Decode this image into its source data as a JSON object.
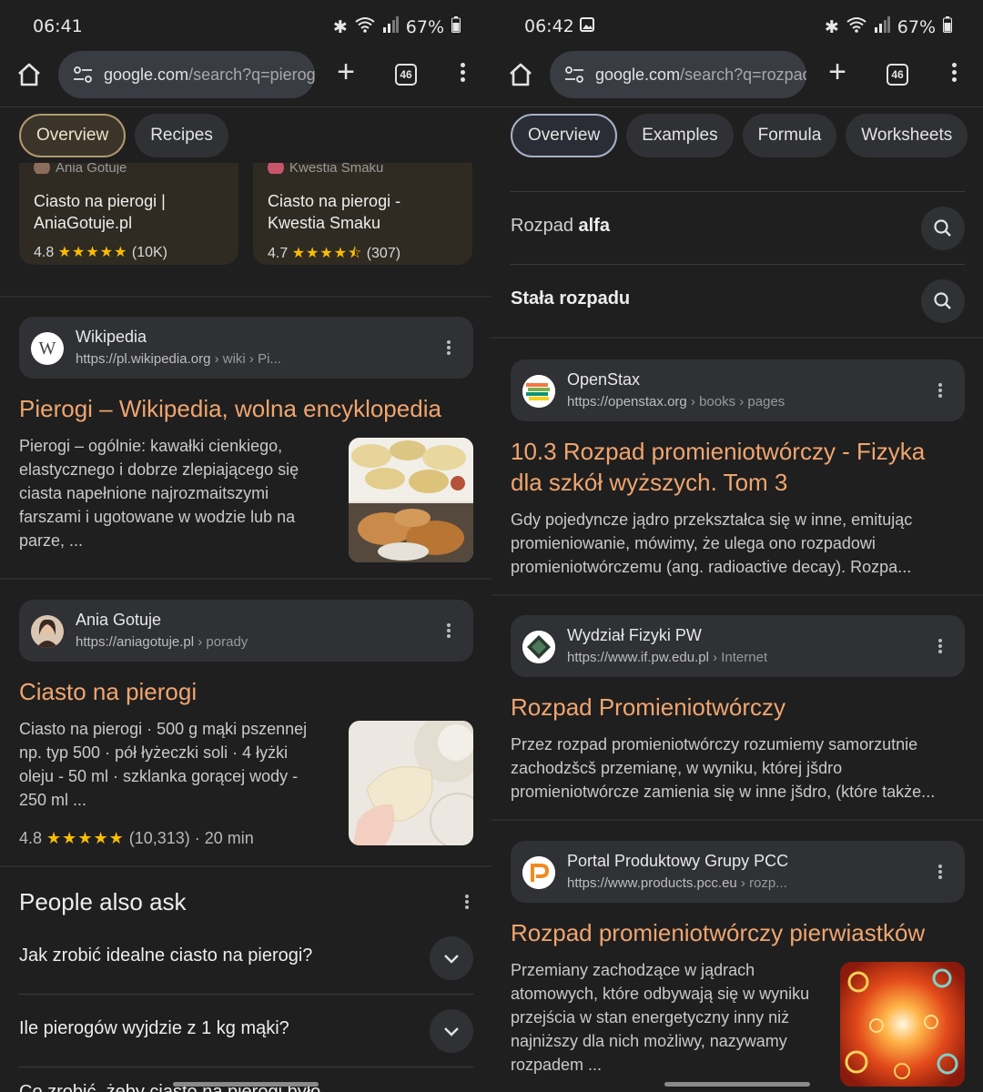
{
  "left": {
    "status": {
      "time": "06:41",
      "battery": "67%"
    },
    "toolbar": {
      "url_main": "google.com",
      "url_rest": "/search?q=pierogi",
      "tab_count": "46"
    },
    "chips": [
      "Overview",
      "Recipes"
    ],
    "recipes": [
      {
        "source": "Ania Gotuje",
        "title": "Ciasto na pierogi | AniaGotuje.pl",
        "rating": "4.8",
        "stars": "★★★★★",
        "count": "(10K)"
      },
      {
        "source": "Kwestia Smaku",
        "title": "Ciasto na pierogi - Kwestia Smaku",
        "rating": "4.7",
        "stars": "★★★★⯪",
        "count": "(307)"
      }
    ],
    "results": [
      {
        "site_name": "Wikipedia",
        "url_main": "https://pl.wikipedia.org",
        "url_rest": " › wiki › Pi...",
        "title": "Pierogi – Wikipedia, wolna encyklopedia",
        "snippet_lines": [
          "Pierogi – ogólnie: kawałki cienkiego,",
          "elastycznego i dobrze zlepiającego się",
          "ciasta napełnione najrozmaitszymi",
          "farszami i ugotowane w wodzie lub na",
          "parze, ..."
        ]
      },
      {
        "site_name": "Ania Gotuje",
        "url_main": "https://aniagotuje.pl",
        "url_rest": " › porady",
        "title": "Ciasto na pierogi",
        "snippet_lines": [
          "Ciasto na pierogi · 500 g mąki pszennej",
          "np. typ 500 · pół łyżeczki soli · 4 łyżki",
          "oleju - 50 ml · szklanka gorącej wody -",
          "250 ml ..."
        ],
        "rating": "4.8",
        "stars": "★★★★★",
        "meta": "(10,313) · 20 min"
      }
    ],
    "paa": {
      "title": "People also ask",
      "questions": [
        "Jak zrobić idealne ciasto na pierogi?",
        "Ile pierogów wyjdzie z 1 kg mąki?",
        "Co zrobić, żeby ciasto na pierogi było"
      ]
    }
  },
  "right": {
    "status": {
      "time": "06:42",
      "battery": "67%"
    },
    "toolbar": {
      "url_main": "google.com",
      "url_rest": "/search?q=rozpad",
      "tab_count": "46"
    },
    "chips": [
      "Overview",
      "Examples",
      "Formula",
      "Worksheets"
    ],
    "related": [
      {
        "prefix": "Rozpad ",
        "bold": "alfa"
      },
      {
        "prefix": "",
        "bold": "Stała rozpadu"
      }
    ],
    "results": [
      {
        "site_name": "OpenStax",
        "url_main": "https://openstax.org",
        "url_rest": " › books › pages",
        "title_lines": [
          "10.3 Rozpad promieniotwórczy - Fizyka",
          "dla szkół wyższych. Tom 3"
        ],
        "snippet_lines": [
          "Gdy pojedyncze jądro przekształca się w inne, emitując",
          "promieniowanie, mówimy, że ulega ono rozpadowi",
          "promieniotwórczemu (ang. radioactive decay). Rozpa..."
        ]
      },
      {
        "site_name": "Wydział Fizyki PW",
        "url_main": "https://www.if.pw.edu.pl",
        "url_rest": " › Internet",
        "title_lines": [
          "Rozpad Promieniotwórczy"
        ],
        "snippet_lines": [
          "Przez rozpad promieniotwórczy rozumiemy samorzutnie",
          "zachodzšcš przemianę, w wyniku, której jšdro",
          "promieniotwórcze zamienia się w inne jšdro, (które także..."
        ]
      },
      {
        "site_name": "Portal Produktowy Grupy PCC",
        "url_main": "https://www.products.pcc.eu",
        "url_rest": " › rozp...",
        "title_lines": [
          "Rozpad promieniotwórczy pierwiastków"
        ],
        "snippet_lines": [
          "Przemiany zachodzące w jądrach",
          "atomowych, które odbywają się w wyniku",
          "przejścia w stan energetyczny inny niż",
          "najniższy dla nich możliwy, nazywamy",
          "rozpadem ..."
        ]
      }
    ]
  }
}
